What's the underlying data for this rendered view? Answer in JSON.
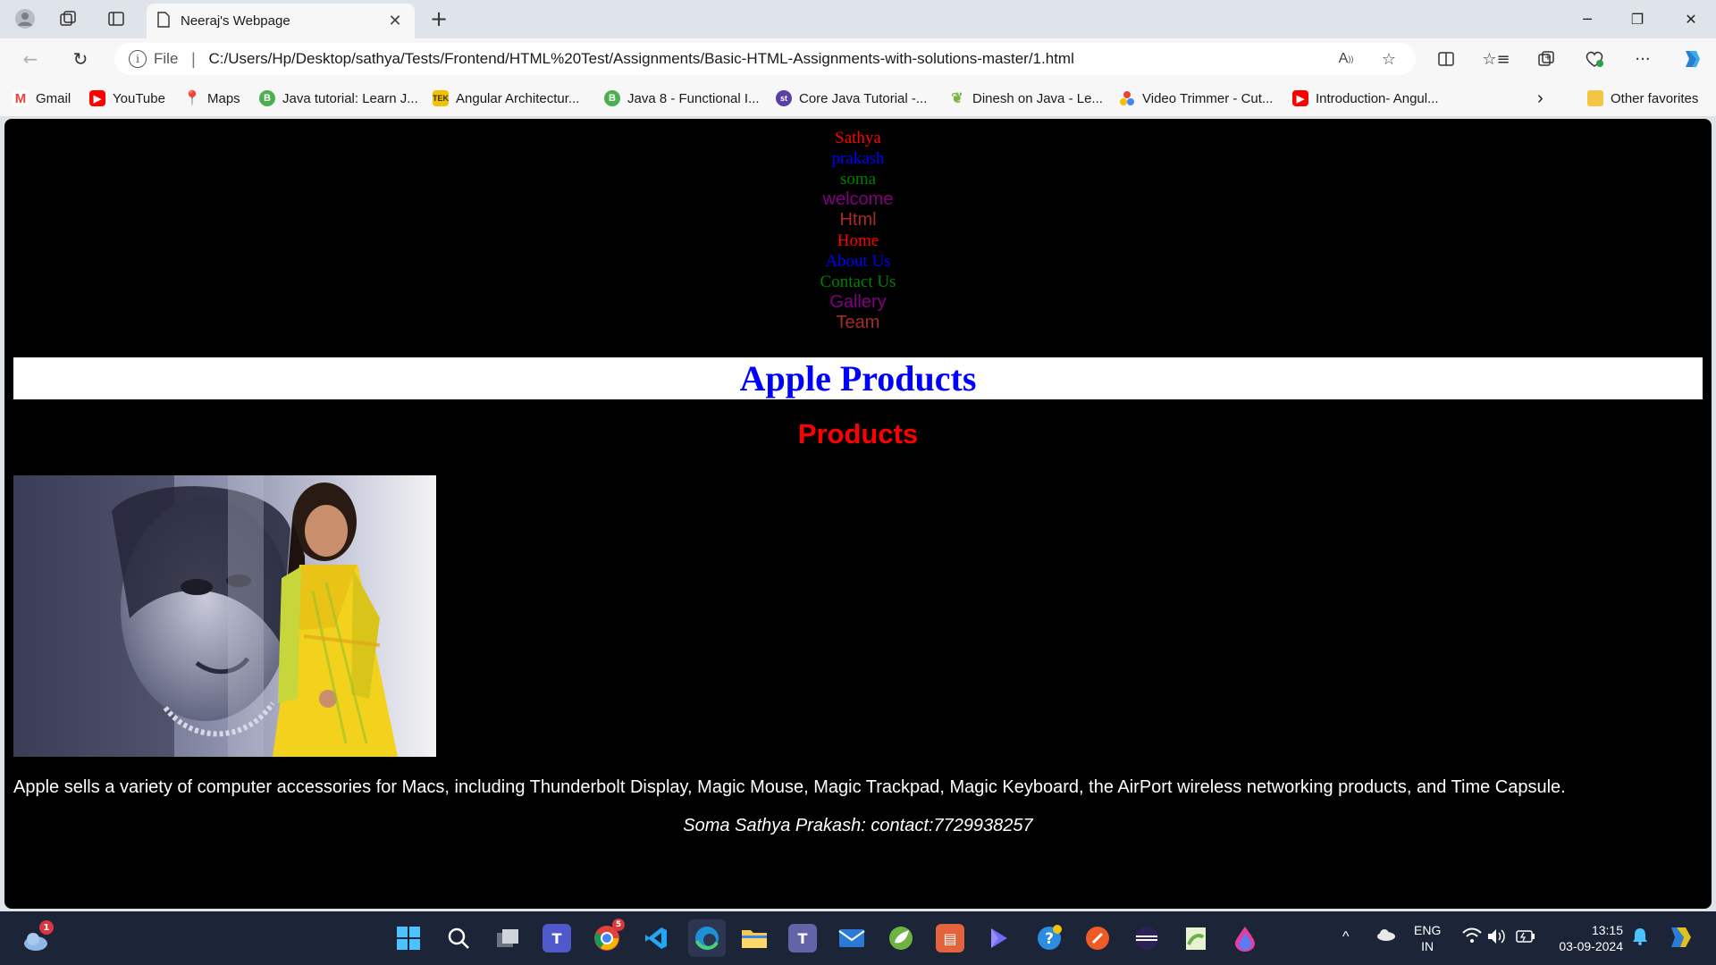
{
  "browser": {
    "tab_title": "Neeraj's Webpage",
    "address_scheme_label": "File",
    "url": "C:/Users/Hp/Desktop/sathya/Tests/Frontend/HTML%20Test/Assignments/Basic-HTML-Assignments-with-solutions-master/1.html"
  },
  "bookmarks": [
    {
      "label": "Gmail",
      "icon": "gmail-icon",
      "color": "#ea4335"
    },
    {
      "label": "YouTube",
      "icon": "youtube-icon",
      "color": "#ff0000"
    },
    {
      "label": "Maps",
      "icon": "maps-icon",
      "color": "#34a853"
    },
    {
      "label": "Java tutorial: Learn J...",
      "icon": "b-icon",
      "color": "#4caf50"
    },
    {
      "label": "Angular Architectur...",
      "icon": "tek-icon",
      "color": "#c9a400"
    },
    {
      "label": "Java 8 - Functional I...",
      "icon": "b-icon",
      "color": "#4caf50"
    },
    {
      "label": "Core Java Tutorial -...",
      "icon": "st-icon",
      "color": "#5b3fa8"
    },
    {
      "label": "Dinesh on Java - Le...",
      "icon": "leaf-icon",
      "color": "#7cb342"
    },
    {
      "label": "Video Trimmer - Cut...",
      "icon": "dots-icon",
      "color": "#4285f4"
    },
    {
      "label": "Introduction- Angul...",
      "icon": "youtube-icon",
      "color": "#ff0000"
    }
  ],
  "other_favorites": "Other favorites",
  "page": {
    "nav_items": [
      {
        "text": "Sathya",
        "color": "#ff0000",
        "style": "serif"
      },
      {
        "text": "prakash",
        "color": "#0000ff",
        "style": "serif"
      },
      {
        "text": "soma",
        "color": "#008000",
        "style": "serif"
      },
      {
        "text": "welcome",
        "color": "#800080",
        "style": "sans"
      },
      {
        "text": "Html",
        "color": "#a52a2a",
        "style": "sans"
      },
      {
        "text": "Home",
        "color": "#ff0000",
        "style": "serif"
      },
      {
        "text": "About Us",
        "color": "#0000ff",
        "style": "serif"
      },
      {
        "text": "Contact Us",
        "color": "#008000",
        "style": "serif"
      },
      {
        "text": "Gallery",
        "color": "#800080",
        "style": "sans"
      },
      {
        "text": "Team",
        "color": "#a52a2a",
        "style": "sans"
      }
    ],
    "heading": "Apple Products",
    "subheading": "Products",
    "paragraph": "Apple sells a variety of computer accessories for Macs, including Thunderbolt Display, Magic Mouse, Magic Trackpad, Magic Keyboard, the AirPort wireless networking products, and Time Capsule.",
    "footer": "Soma Sathya Prakash: contact:7729938257"
  },
  "taskbar": {
    "weather_badge": "1",
    "chrome_badge": "5",
    "lang_line1": "ENG",
    "lang_line2": "IN",
    "time": "13:15",
    "date": "03-09-2024"
  }
}
